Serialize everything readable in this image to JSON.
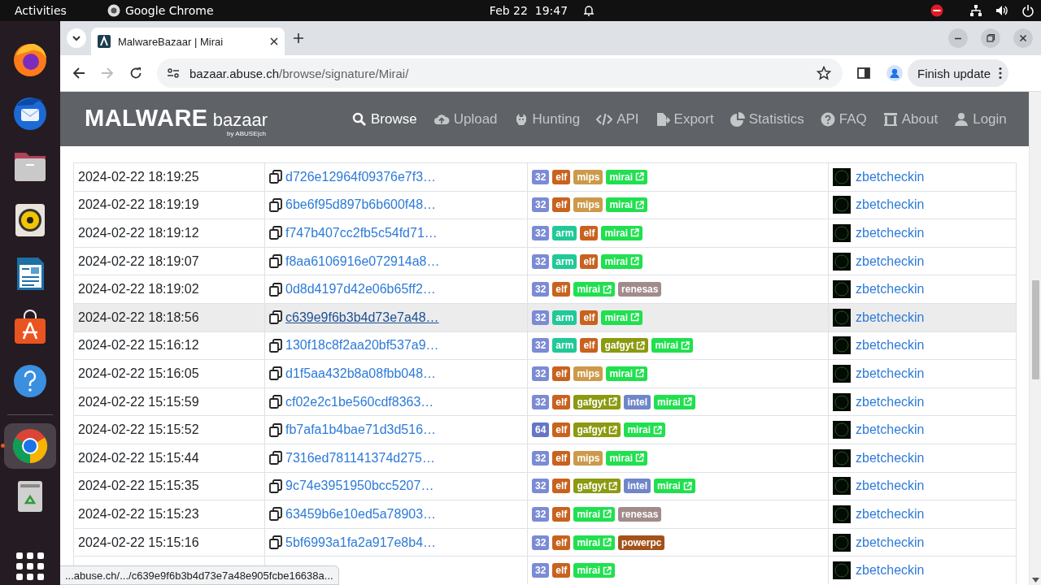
{
  "top_bar": {
    "activities": "Activities",
    "app": "Google Chrome",
    "clock": "Feb 22  19:47"
  },
  "dock": {
    "items": [
      {
        "kind": "firefox",
        "active": false
      },
      {
        "kind": "thunderbird",
        "active": false
      },
      {
        "kind": "files",
        "active": false
      },
      {
        "kind": "rhythmbox",
        "active": false
      },
      {
        "kind": "writer",
        "active": false
      },
      {
        "kind": "software",
        "active": false
      },
      {
        "kind": "help",
        "active": false
      }
    ],
    "after_separator": [
      {
        "kind": "chrome",
        "active": true
      },
      {
        "kind": "trash",
        "active": false
      },
      {
        "kind": "apps",
        "active": false
      }
    ]
  },
  "browser": {
    "tab_title": "MalwareBazaar | Mirai",
    "url_host": "bazaar.abuse.ch",
    "url_path": "/browse/signature/Mirai/",
    "update_button": "Finish update"
  },
  "site_header": {
    "logo": "MALWARE",
    "logo_sub": "bazaar",
    "logo_by": "by ABUSE|ch",
    "nav": [
      {
        "label": "Browse",
        "selected": true
      },
      {
        "label": "Upload",
        "selected": false
      },
      {
        "label": "Hunting",
        "selected": false
      },
      {
        "label": "API",
        "selected": false
      },
      {
        "label": "Export",
        "selected": false
      },
      {
        "label": "Statistics",
        "selected": false
      },
      {
        "label": "FAQ",
        "selected": false
      },
      {
        "label": "About",
        "selected": false
      },
      {
        "label": "Login",
        "selected": false
      }
    ]
  },
  "table": {
    "rows": [
      {
        "date": "2024-02-22 18:19:25",
        "hash": "d726e12964f09376e7f3…",
        "highlighted": false,
        "tags": [
          {
            "label": "32",
            "color": "#7b8bd4",
            "link": false
          },
          {
            "label": "elf",
            "color": "#c8621f",
            "link": false
          },
          {
            "label": "mips",
            "color": "#cc9a4a",
            "link": false
          },
          {
            "label": "mirai",
            "color": "#20e04f",
            "link": true
          }
        ],
        "reporter": "zbetcheckin"
      },
      {
        "date": "2024-02-22 18:19:19",
        "hash": "6be6f95d897b6b600f48…",
        "highlighted": false,
        "tags": [
          {
            "label": "32",
            "color": "#7b8bd4",
            "link": false
          },
          {
            "label": "elf",
            "color": "#c8621f",
            "link": false
          },
          {
            "label": "mips",
            "color": "#cc9a4a",
            "link": false
          },
          {
            "label": "mirai",
            "color": "#20e04f",
            "link": true
          }
        ],
        "reporter": "zbetcheckin"
      },
      {
        "date": "2024-02-22 18:19:12",
        "hash": "f747b407cc2fb5c54fd71…",
        "highlighted": false,
        "tags": [
          {
            "label": "32",
            "color": "#7b8bd4",
            "link": false
          },
          {
            "label": "arm",
            "color": "#20c997",
            "link": false
          },
          {
            "label": "elf",
            "color": "#c8621f",
            "link": false
          },
          {
            "label": "mirai",
            "color": "#20e04f",
            "link": true
          }
        ],
        "reporter": "zbetcheckin"
      },
      {
        "date": "2024-02-22 18:19:07",
        "hash": "f8aa6106916e072914a8…",
        "highlighted": false,
        "tags": [
          {
            "label": "32",
            "color": "#7b8bd4",
            "link": false
          },
          {
            "label": "arm",
            "color": "#20c997",
            "link": false
          },
          {
            "label": "elf",
            "color": "#c8621f",
            "link": false
          },
          {
            "label": "mirai",
            "color": "#20e04f",
            "link": true
          }
        ],
        "reporter": "zbetcheckin"
      },
      {
        "date": "2024-02-22 18:19:02",
        "hash": "0d8d4197d42e06b65ff2…",
        "highlighted": false,
        "tags": [
          {
            "label": "32",
            "color": "#7b8bd4",
            "link": false
          },
          {
            "label": "elf",
            "color": "#c8621f",
            "link": false
          },
          {
            "label": "mirai",
            "color": "#20e04f",
            "link": true
          },
          {
            "label": "renesas",
            "color": "#a18b8b",
            "link": false
          }
        ],
        "reporter": "zbetcheckin"
      },
      {
        "date": "2024-02-22 18:18:56",
        "hash": "c639e9f6b3b4d73e7a48…",
        "highlighted": true,
        "tags": [
          {
            "label": "32",
            "color": "#7b8bd4",
            "link": false
          },
          {
            "label": "arm",
            "color": "#20c997",
            "link": false
          },
          {
            "label": "elf",
            "color": "#c8621f",
            "link": false
          },
          {
            "label": "mirai",
            "color": "#20e04f",
            "link": true
          }
        ],
        "reporter": "zbetcheckin"
      },
      {
        "date": "2024-02-22 15:16:12",
        "hash": "130f18c8f2aa20bf537a9…",
        "highlighted": false,
        "tags": [
          {
            "label": "32",
            "color": "#7b8bd4",
            "link": false
          },
          {
            "label": "arm",
            "color": "#20c997",
            "link": false
          },
          {
            "label": "elf",
            "color": "#c8621f",
            "link": false
          },
          {
            "label": "gafgyt",
            "color": "#8b9a10",
            "link": true
          },
          {
            "label": "mirai",
            "color": "#20e04f",
            "link": true
          }
        ],
        "reporter": "zbetcheckin"
      },
      {
        "date": "2024-02-22 15:16:05",
        "hash": "d1f5aa432b8a08fbb048…",
        "highlighted": false,
        "tags": [
          {
            "label": "32",
            "color": "#7b8bd4",
            "link": false
          },
          {
            "label": "elf",
            "color": "#c8621f",
            "link": false
          },
          {
            "label": "mips",
            "color": "#cc9a4a",
            "link": false
          },
          {
            "label": "mirai",
            "color": "#20e04f",
            "link": true
          }
        ],
        "reporter": "zbetcheckin"
      },
      {
        "date": "2024-02-22 15:15:59",
        "hash": "cf02e2c1be560cdf8363…",
        "highlighted": false,
        "tags": [
          {
            "label": "32",
            "color": "#7b8bd4",
            "link": false
          },
          {
            "label": "elf",
            "color": "#c8621f",
            "link": false
          },
          {
            "label": "gafgyt",
            "color": "#8b9a10",
            "link": true
          },
          {
            "label": "intel",
            "color": "#6f86c9",
            "link": false
          },
          {
            "label": "mirai",
            "color": "#20e04f",
            "link": true
          }
        ],
        "reporter": "zbetcheckin"
      },
      {
        "date": "2024-02-22 15:15:52",
        "hash": "fb7afa1b4bae71d3d516…",
        "highlighted": false,
        "tags": [
          {
            "label": "64",
            "color": "#6676c6",
            "link": false
          },
          {
            "label": "elf",
            "color": "#c8621f",
            "link": false
          },
          {
            "label": "gafgyt",
            "color": "#8b9a10",
            "link": true
          },
          {
            "label": "mirai",
            "color": "#20e04f",
            "link": true
          }
        ],
        "reporter": "zbetcheckin"
      },
      {
        "date": "2024-02-22 15:15:44",
        "hash": "7316ed781141374d275…",
        "highlighted": false,
        "tags": [
          {
            "label": "32",
            "color": "#7b8bd4",
            "link": false
          },
          {
            "label": "elf",
            "color": "#c8621f",
            "link": false
          },
          {
            "label": "mips",
            "color": "#cc9a4a",
            "link": false
          },
          {
            "label": "mirai",
            "color": "#20e04f",
            "link": true
          }
        ],
        "reporter": "zbetcheckin"
      },
      {
        "date": "2024-02-22 15:15:35",
        "hash": "9c74e3951950bcc5207…",
        "highlighted": false,
        "tags": [
          {
            "label": "32",
            "color": "#7b8bd4",
            "link": false
          },
          {
            "label": "elf",
            "color": "#c8621f",
            "link": false
          },
          {
            "label": "gafgyt",
            "color": "#8b9a10",
            "link": true
          },
          {
            "label": "intel",
            "color": "#6f86c9",
            "link": false
          },
          {
            "label": "mirai",
            "color": "#20e04f",
            "link": true
          }
        ],
        "reporter": "zbetcheckin"
      },
      {
        "date": "2024-02-22 15:15:23",
        "hash": "63459b6e10ed5a78903…",
        "highlighted": false,
        "tags": [
          {
            "label": "32",
            "color": "#7b8bd4",
            "link": false
          },
          {
            "label": "elf",
            "color": "#c8621f",
            "link": false
          },
          {
            "label": "mirai",
            "color": "#20e04f",
            "link": true
          },
          {
            "label": "renesas",
            "color": "#a18b8b",
            "link": false
          }
        ],
        "reporter": "zbetcheckin"
      },
      {
        "date": "2024-02-22 15:15:16",
        "hash": "5bf6993a1fa2a917e8b4…",
        "highlighted": false,
        "tags": [
          {
            "label": "32",
            "color": "#7b8bd4",
            "link": false
          },
          {
            "label": "elf",
            "color": "#c8621f",
            "link": false
          },
          {
            "label": "mirai",
            "color": "#20e04f",
            "link": true
          },
          {
            "label": "powerpc",
            "color": "#a3521b",
            "link": false
          }
        ],
        "reporter": "zbetcheckin"
      },
      {
        "highlighted": false,
        "tags": [
          {
            "label": "32",
            "color": "#7b8bd4",
            "link": false
          },
          {
            "label": "elf",
            "color": "#c8621f",
            "link": false
          },
          {
            "label": "mirai",
            "color": "#20e04f",
            "link": true
          }
        ],
        "reporter": "zbetcheckin"
      }
    ]
  },
  "status_url": "...abuse.ch/.../c639e9f6b3b4d73e7a48e905fcbe16638a..."
}
